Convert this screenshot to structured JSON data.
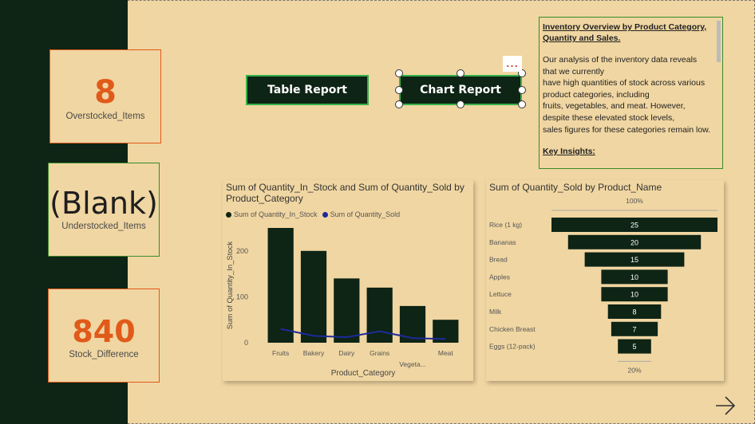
{
  "cards": {
    "overstocked": {
      "value": "8",
      "label": "Overstocked_Items"
    },
    "understocked": {
      "value": "(Blank)",
      "label": "Understocked_Items"
    },
    "stock_difference": {
      "value": "840",
      "label": "Stock_Difference"
    }
  },
  "buttons": {
    "table_report": "Table Report",
    "chart_report": "Chart Report",
    "more_options": "..."
  },
  "textbox": {
    "title_line1": "Inventory Overview by Product Category,",
    "title_line2": "Quantity and Sales.",
    "body_lines": [
      "Our analysis of the inventory data reveals",
      "that we currently",
      "have high quantities of stock across various",
      "product categories, including",
      "fruits, vegetables, and meat. However,",
      "despite these elevated stock levels,",
      "sales figures for these categories remain low."
    ],
    "insights_heading": "Key Insights:"
  },
  "chart_data": [
    {
      "type": "bar",
      "title": "Sum of Quantity_In_Stock and Sum of Quantity_Sold by Product_Category",
      "title_line1": "Sum of Quantity_In_Stock and Sum of Quantity_Sold by",
      "title_line2": "Product_Category",
      "xlabel": "Product_Category",
      "ylabel": "Sum of Quantity_In_Stock",
      "categories": [
        "Fruits",
        "Bakery",
        "Dairy",
        "Grains",
        "Vegeta...",
        "Meat"
      ],
      "ylim": [
        0,
        250
      ],
      "yticks": [
        "0",
        "100",
        "200"
      ],
      "series": [
        {
          "name": "Sum of  Quantity_In_Stock",
          "type": "bar",
          "color": "#0e2415",
          "values": [
            250,
            200,
            140,
            120,
            80,
            50
          ]
        },
        {
          "name": "Sum of  Quantity_Sold",
          "type": "line",
          "color": "#1e2a9a",
          "values": [
            30,
            15,
            12,
            25,
            10,
            8
          ]
        }
      ],
      "legend": "top-left"
    },
    {
      "type": "funnel",
      "title": "Sum of Quantity_Sold by Product_Name",
      "categories": [
        "Rice (1 kg)",
        "Bananas",
        "Bread",
        "Apples",
        "Lettuce",
        "Milk",
        "Chicken Breast",
        "Eggs (12-pack)"
      ],
      "values": [
        25,
        20,
        15,
        10,
        10,
        8,
        7,
        5
      ],
      "top_label": "100%",
      "bottom_label": "20%",
      "color": "#0e2415"
    }
  ],
  "colors": {
    "sidebar": "#0e2415",
    "background": "#f0d6a2",
    "accent_orange": "#e05a1a",
    "accent_green": "#35b04a"
  },
  "nav": {
    "next_icon": "arrow-right-icon"
  }
}
